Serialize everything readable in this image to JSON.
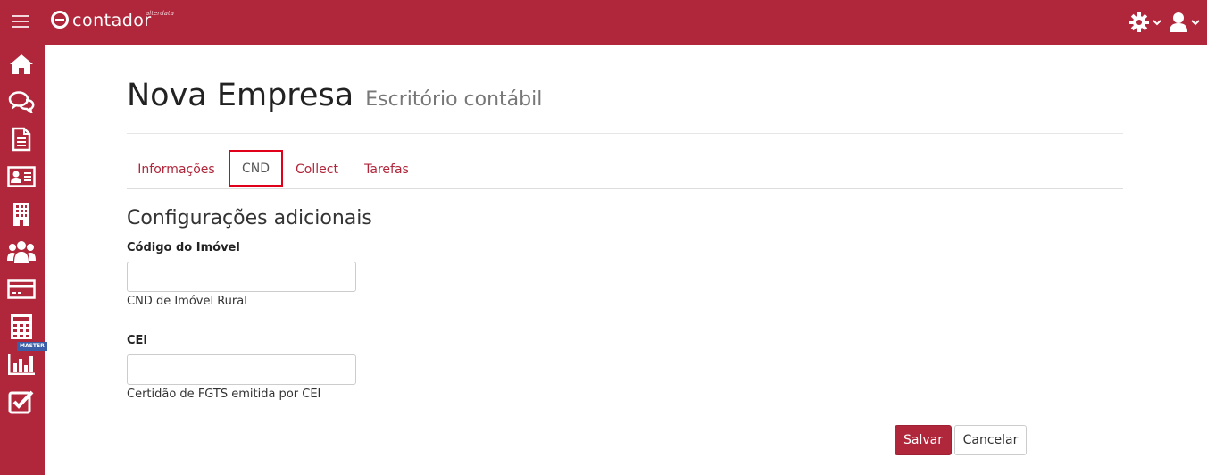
{
  "app": {
    "logo_text": "contador",
    "logo_small": "alterdata",
    "master_badge": "MASTER"
  },
  "colors": {
    "brand": "#b0263a",
    "tab_highlight": "#e0001a"
  },
  "sidebar": {
    "items": [
      {
        "icon": "home-icon"
      },
      {
        "icon": "chat-icon"
      },
      {
        "icon": "document-icon"
      },
      {
        "icon": "id-card-icon"
      },
      {
        "icon": "building-icon"
      },
      {
        "icon": "users-icon"
      },
      {
        "icon": "credit-card-icon"
      },
      {
        "icon": "calculator-icon"
      },
      {
        "icon": "bar-chart-icon"
      },
      {
        "icon": "checkbox-icon"
      }
    ]
  },
  "header": {
    "title": "Nova Empresa",
    "subtitle": "Escritório contábil"
  },
  "tabs": [
    {
      "label": "Informações",
      "active": false
    },
    {
      "label": "CND",
      "active": true
    },
    {
      "label": "Collect",
      "active": false
    },
    {
      "label": "Tarefas",
      "active": false
    }
  ],
  "form": {
    "section_title": "Configurações adicionais",
    "fields": [
      {
        "label": "Código do Imóvel",
        "value": "",
        "help": "CND de Imóvel Rural"
      },
      {
        "label": "CEI",
        "value": "",
        "help": "Certidão de FGTS emitida por CEI"
      }
    ],
    "save_label": "Salvar",
    "cancel_label": "Cancelar"
  }
}
